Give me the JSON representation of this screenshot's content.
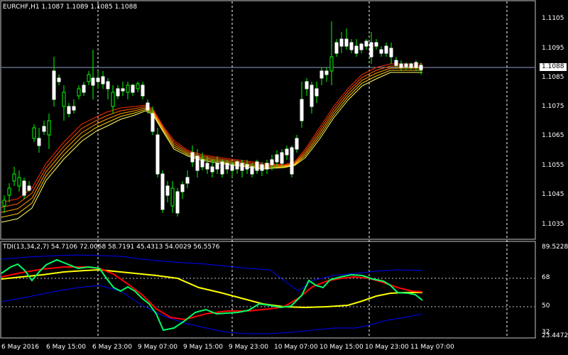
{
  "main_chart": {
    "header": "EURCHF,H1  1.1087 1.1089 1.1085 1.1088",
    "price_axis_labels": [
      "1.1105",
      "1.1095",
      "1.1085",
      "1.1075",
      "1.1065",
      "1.1055",
      "1.1045",
      "1.1035"
    ],
    "current_price": "1.1088"
  },
  "indicator": {
    "header": "TDI(13,34,2,7) 54.7106 72.0068 58.7191 45.4313 54.0029 56.5576",
    "axis_labels": [
      "89.5228",
      "68",
      "50",
      "32",
      "23.4472"
    ]
  },
  "time_axis": {
    "labels": [
      "6 May 2016",
      "6 May 15:00",
      "6 May 23:00",
      "9 May 07:00",
      "9 May 15:00",
      "9 May 23:00",
      "10 May 07:00",
      "10 May 15:00",
      "10 May 23:00",
      "11 May 07:00"
    ]
  },
  "colors": {
    "background": "#000000",
    "grid": "#c8c8c8",
    "bull": "#00ff00",
    "bear": "#ffffff",
    "ribbon_red": "#ff0000",
    "ribbon_yellow": "#ffff00",
    "tdi_green": "#00ff66",
    "tdi_red": "#ff0000",
    "tdi_yellow": "#ffff00",
    "tdi_blue": "#0000ff"
  }
}
